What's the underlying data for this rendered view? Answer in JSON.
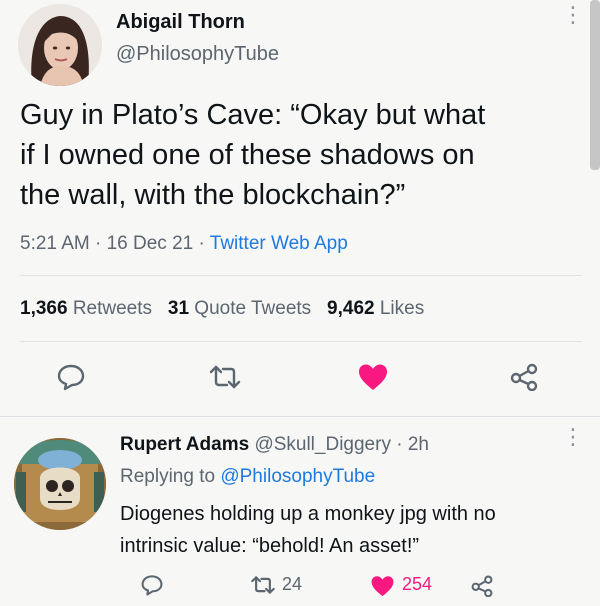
{
  "tweet": {
    "author_name": "Abigail Thorn",
    "author_handle": "@PhilosophyTube",
    "text_lines": [
      "Guy in Plato’s Cave: “Okay but what",
      "if I owned one of these shadows on",
      "the wall, with the blockchain?”"
    ],
    "time": "5:21 AM",
    "date": "16 Dec 21",
    "source": "Twitter Web App",
    "separator": "·",
    "stats": {
      "retweets_count": "1,366",
      "retweets_label": "Retweets",
      "quotes_count": "31",
      "quotes_label": "Quote Tweets",
      "likes_count": "9,462",
      "likes_label": "Likes"
    }
  },
  "actions": {
    "icons": [
      "reply-icon",
      "retweet-icon",
      "like-icon",
      "share-icon"
    ],
    "like_color": "#f91880"
  },
  "reply": {
    "author_name": "Rupert Adams",
    "author_handle": "@Skull_Diggery",
    "age": "· 2h",
    "replying_prefix": "Replying to",
    "replying_to": "@PhilosophyTube",
    "text_lines": [
      "Diogenes holding up a monkey jpg with no",
      "intrinsic value: “behold! An asset!”"
    ],
    "retweets": "24",
    "likes": "254"
  },
  "colors": {
    "link": "#1d7ae0",
    "muted": "#5c6670",
    "like": "#f91880"
  }
}
